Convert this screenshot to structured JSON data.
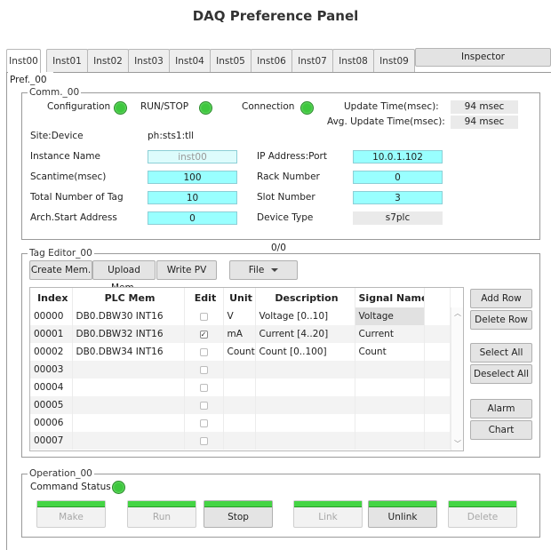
{
  "title": "DAQ Preference Panel",
  "tabs": [
    "Inst00",
    "Inst01",
    "Inst02",
    "Inst03",
    "Inst04",
    "Inst05",
    "Inst06",
    "Inst07",
    "Inst08",
    "Inst09"
  ],
  "inspector_label": "Inspector",
  "pref_legend": "Pref._00",
  "comm": {
    "legend": "Comm._00",
    "configuration_label": "Configuration",
    "runstop_label": "RUN/STOP",
    "connection_label": "Connection",
    "update_time_label": "Update Time(msec):",
    "update_time_value": "94 msec",
    "avg_update_time_label": "Avg. Update Time(msec):",
    "avg_update_time_value": "94 msec",
    "site_device_label": "Site:Device",
    "site_device_value": "ph:sts1:tll",
    "instance_name_label": "Instance Name",
    "instance_name_value": "inst00",
    "scantime_label": "Scantime(msec)",
    "scantime_value": "100",
    "total_tags_label": "Total Number of Tag",
    "total_tags_value": "10",
    "arch_start_label": "Arch.Start Address",
    "arch_start_value": "0",
    "ip_port_label": "IP Address:Port",
    "ip_port_value": "10.0.1.102",
    "rack_label": "Rack Number",
    "rack_value": "0",
    "slot_label": "Slot Number",
    "slot_value": "3",
    "device_type_label": "Device Type",
    "device_type_value": "s7plc",
    "status_color": "#3ec73e"
  },
  "tag_editor": {
    "legend": "Tag Editor_00",
    "counter": "0/0",
    "create_label": "Create Mem.",
    "upload_label": "Upload Mem.",
    "write_pv_label": "Write PV",
    "file_label": "File",
    "columns": [
      "Index",
      "PLC Mem",
      "Edit",
      "Unit",
      "Description",
      "Signal Name"
    ],
    "rows": [
      {
        "index": "00000",
        "plc": "DB0.DBW30 INT16",
        "edit": false,
        "unit": "V",
        "desc": "Voltage [0..10]",
        "signal": "Voltage"
      },
      {
        "index": "00001",
        "plc": "DB0.DBW32 INT16",
        "edit": true,
        "unit": "mA",
        "desc": "Current [4..20]",
        "signal": "Current"
      },
      {
        "index": "00002",
        "plc": "DB0.DBW34 INT16",
        "edit": false,
        "unit": "Count",
        "desc": "Count [0..100]",
        "signal": "Count"
      },
      {
        "index": "00003",
        "plc": "",
        "edit": false,
        "unit": "",
        "desc": "",
        "signal": ""
      },
      {
        "index": "00004",
        "plc": "",
        "edit": false,
        "unit": "",
        "desc": "",
        "signal": ""
      },
      {
        "index": "00005",
        "plc": "",
        "edit": false,
        "unit": "",
        "desc": "",
        "signal": ""
      },
      {
        "index": "00006",
        "plc": "",
        "edit": false,
        "unit": "",
        "desc": "",
        "signal": ""
      },
      {
        "index": "00007",
        "plc": "",
        "edit": false,
        "unit": "",
        "desc": "",
        "signal": ""
      }
    ],
    "side_buttons": {
      "add_row": "Add Row",
      "delete_row": "Delete Row",
      "select_all": "Select All",
      "deselect_all": "Deselect All",
      "alarm": "Alarm",
      "chart": "Chart"
    }
  },
  "operation": {
    "legend": "Operation_00",
    "command_status_label": "Command Status",
    "buttons": [
      {
        "label": "Make",
        "enabled": false
      },
      {
        "label": "Run",
        "enabled": false
      },
      {
        "label": "Stop",
        "enabled": true
      },
      {
        "label": "Link",
        "enabled": false
      },
      {
        "label": "Unlink",
        "enabled": true
      },
      {
        "label": "Delete",
        "enabled": false
      }
    ]
  }
}
